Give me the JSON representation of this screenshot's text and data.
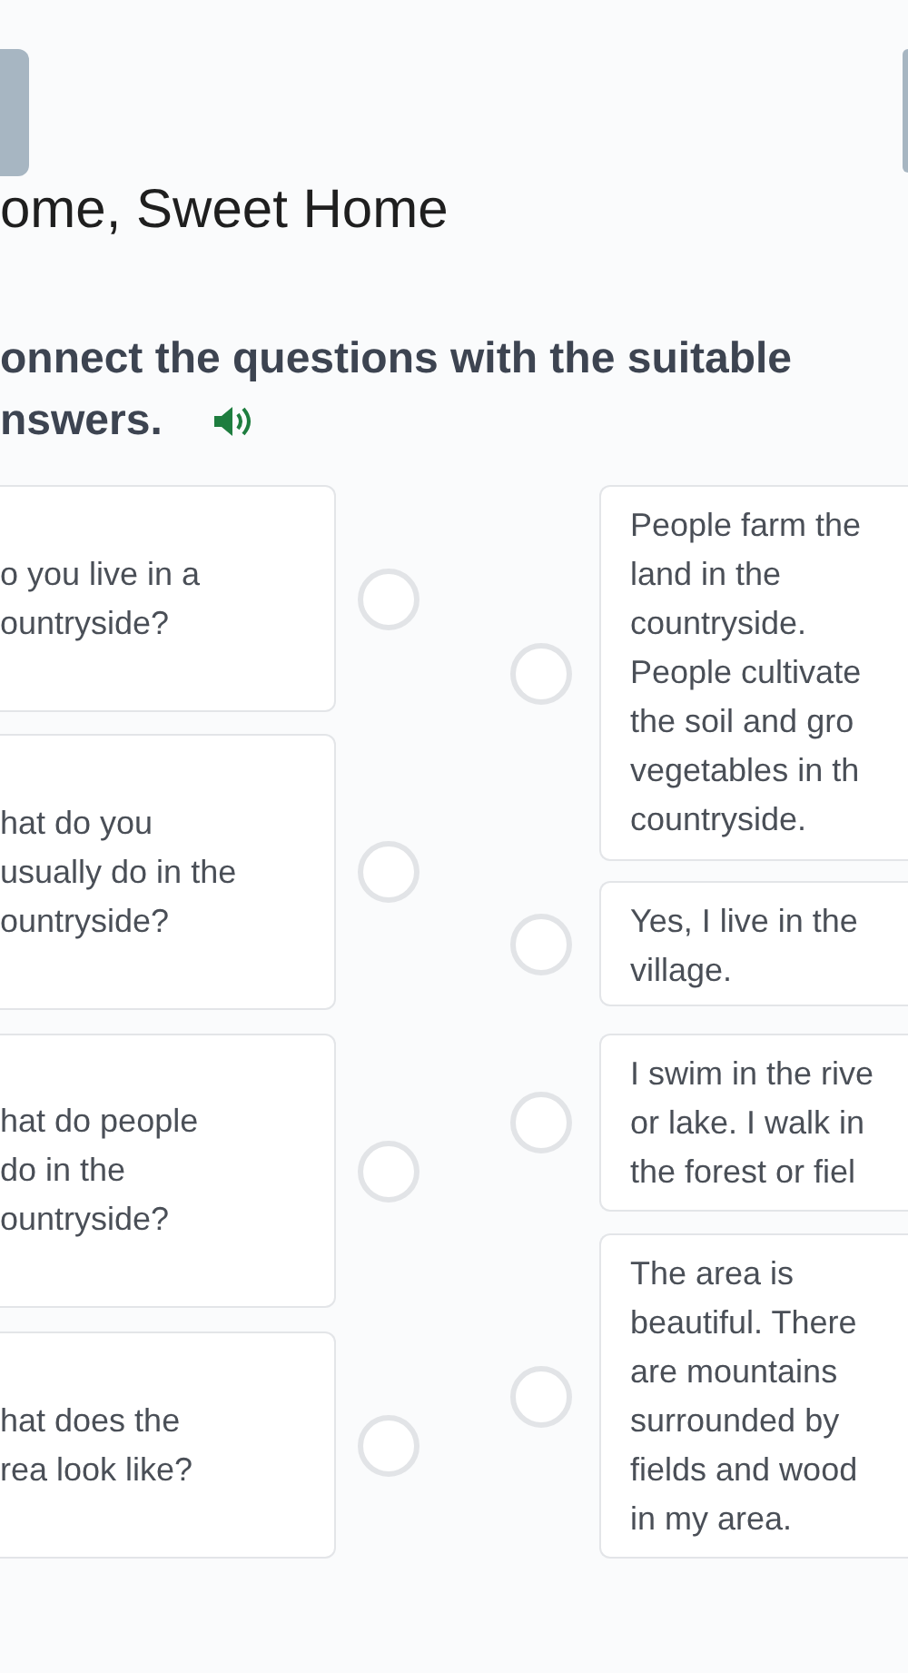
{
  "title": "ome, Sweet Home",
  "instruction": [
    "onnect the questions with the suitable",
    "nswers."
  ],
  "questions": [
    {
      "lines": [
        "o you live in a",
        "ountryside?"
      ]
    },
    {
      "lines": [
        "hat do you",
        "usually do in the",
        "ountryside?"
      ]
    },
    {
      "lines": [
        "hat do people",
        "do in the",
        "ountryside?"
      ]
    },
    {
      "lines": [
        "hat does the",
        "rea look like?"
      ]
    }
  ],
  "answers": [
    {
      "lines": [
        "People farm the",
        "land in the",
        "countryside.",
        "People cultivate",
        "the soil and gro",
        "vegetables in th",
        "countryside."
      ]
    },
    {
      "lines": [
        "Yes, I live in the",
        "village."
      ]
    },
    {
      "lines": [
        "I swim in the rive",
        "or lake. I walk in",
        "the forest or fiel"
      ]
    },
    {
      "lines": [
        "The area is",
        "beautiful. There",
        "are mountains",
        "surrounded by",
        "fields and wood",
        "in my area."
      ]
    }
  ]
}
